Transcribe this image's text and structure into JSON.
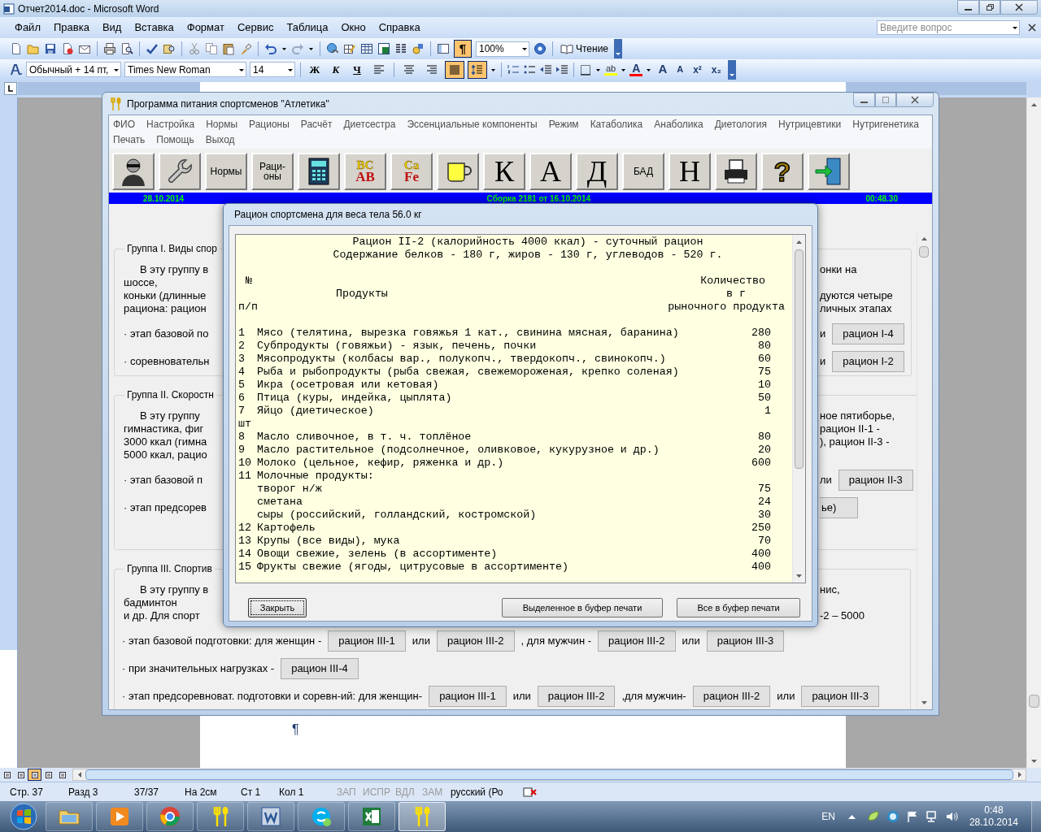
{
  "word": {
    "title": "Отчет2014.doc - Microsoft Word",
    "menu": [
      "Файл",
      "Правка",
      "Вид",
      "Вставка",
      "Формат",
      "Сервис",
      "Таблица",
      "Окно",
      "Справка"
    ],
    "help_box": {
      "placeholder": "Введите вопрос"
    },
    "standard_bar": {
      "pilcrow": {
        "label": "¶",
        "selected": true
      },
      "zoom": "100%",
      "reading": "Чтение"
    },
    "format_bar": {
      "style": "Обычный + 14 пт,",
      "font": "Times New Roman",
      "size": "14",
      "text_buttons": [
        {
          "kind": "bold",
          "label": "Ж",
          "selected": false
        },
        {
          "kind": "italic",
          "label": "К",
          "selected": false
        },
        {
          "kind": "underline",
          "label": "Ч",
          "selected": false
        }
      ],
      "alignment": [
        {
          "kind": "left",
          "selected": false
        },
        {
          "kind": "center",
          "selected": false
        },
        {
          "kind": "right",
          "selected": false
        },
        {
          "kind": "justify",
          "selected": true
        }
      ],
      "line_spacing": {
        "selected": true
      },
      "highlight": "ab",
      "font_color": "A",
      "size_buttons": [
        {
          "kind": "grow",
          "label": "A"
        },
        {
          "kind": "shrink",
          "label": "A"
        },
        {
          "kind": "superscript",
          "label": "x²"
        },
        {
          "kind": "subscript",
          "label": "x₂"
        }
      ]
    },
    "document": {
      "pilcrow": "¶"
    },
    "view_buttons": [
      {
        "selected": false
      },
      {
        "selected": false
      },
      {
        "selected": true
      },
      {
        "selected": false
      },
      {
        "selected": false
      }
    ],
    "status_bar": [
      {
        "text": "Стр. 37",
        "disabled": false
      },
      {
        "text": "Разд 3",
        "disabled": false
      },
      {
        "text": "37/37",
        "disabled": false
      },
      {
        "text": "На 2см",
        "disabled": false
      },
      {
        "text": "Ст 1",
        "disabled": false
      },
      {
        "text": "Кол 1",
        "disabled": false
      },
      {
        "text": "ЗАП",
        "disabled": true
      },
      {
        "text": "ИСПР",
        "disabled": true
      },
      {
        "text": "ВДЛ",
        "disabled": true
      },
      {
        "text": "ЗАМ",
        "disabled": true
      },
      {
        "text": "русский (Ро",
        "disabled": false
      }
    ]
  },
  "app": {
    "title": "Программа питания спортсменов \"Атлетика\"",
    "menu_rows": [
      [
        "ФИО",
        "Настройка",
        "Нормы",
        "Рационы",
        "Расчёт",
        "Диетсестра",
        "Эссенциальные компоненты",
        "Режим",
        "Катаболика",
        "Анаболика",
        "Диетология",
        "Нутрицевтики",
        "Нутригенетика"
      ],
      [
        "Печать",
        "Помощь",
        "Выход"
      ]
    ],
    "toolbar": [
      {
        "kind": "icon"
      },
      {
        "kind": "icon"
      },
      {
        "kind": "text",
        "label": "Нормы"
      },
      {
        "kind": "text",
        "label": "Раци-\nоны"
      },
      {
        "kind": "icon"
      },
      {
        "kind": "letters",
        "top": "BC",
        "bottom": "AB"
      },
      {
        "kind": "letters",
        "top": "Ca",
        "bottom": "Fe"
      },
      {
        "kind": "icon"
      },
      {
        "kind": "letter",
        "label": "К"
      },
      {
        "kind": "letter",
        "label": "А"
      },
      {
        "kind": "letter",
        "label": "Д"
      },
      {
        "kind": "text",
        "label": "БАД"
      },
      {
        "kind": "letter",
        "label": "Н"
      },
      {
        "kind": "icon"
      },
      {
        "kind": "glyph",
        "label": "?"
      },
      {
        "kind": "icon"
      }
    ],
    "info_bar": {
      "date": "28.10.2014",
      "build": "Сборка 2181 от 16.10.2014",
      "time": "00:48.30"
    },
    "groups": [
      {
        "title": "Группа I. Виды спор",
        "lines": [
          {
            "kind": "first",
            "left": [
              {
                "kind": "text",
                "text": "В эту группу в"
              }
            ],
            "right": [
              {
                "kind": "text",
                "text": "онки на"
              }
            ]
          },
          {
            "kind": "text",
            "left": [
              {
                "kind": "text",
                "text": "шоссе,"
              }
            ]
          },
          {
            "kind": "text",
            "left": [
              {
                "kind": "text",
                "text": "коньки (длинные"
              }
            ],
            "right": [
              {
                "kind": "text",
                "text": "дуются четыре"
              }
            ]
          },
          {
            "kind": "text",
            "left": [
              {
                "kind": "text",
                "text": "рациона:  рацион"
              }
            ],
            "right": [
              {
                "kind": "text",
                "text": "личных  этапах"
              }
            ]
          },
          {
            "kind": "controls",
            "left": [
              {
                "kind": "text",
                "text": "· этап базовой по"
              }
            ],
            "right": [
              {
                "kind": "text",
                "text": "и"
              },
              {
                "kind": "button",
                "text": "рацион I-4"
              }
            ]
          },
          {
            "kind": "controls",
            "left": [
              {
                "kind": "text",
                "text": "· соревновательн"
              }
            ],
            "right": [
              {
                "kind": "text",
                "text": "и"
              },
              {
                "kind": "button",
                "text": "рацион I-2"
              }
            ]
          }
        ]
      },
      {
        "title": "Группа II. Скоростн",
        "lines": [
          {
            "kind": "first",
            "left": [
              {
                "kind": "text",
                "text": "В  эту  группу"
              }
            ],
            "right": [
              {
                "kind": "text",
                "text": "ное  пятиборье,"
              }
            ]
          },
          {
            "kind": "text",
            "left": [
              {
                "kind": "text",
                "text": "гимнастика,  фиг"
              }
            ],
            "right": [
              {
                "kind": "text",
                "text": "рацион II-1 -"
              }
            ]
          },
          {
            "kind": "text",
            "left": [
              {
                "kind": "text",
                "text": "3000 ккал (гимна"
              }
            ],
            "right": [
              {
                "kind": "text",
                "text": "), рацион II-3 -"
              }
            ]
          },
          {
            "kind": "text",
            "left": [
              {
                "kind": "text",
                "text": "5000 ккал, рацио"
              }
            ]
          },
          {
            "kind": "controls",
            "left": [
              {
                "kind": "text",
                "text": "· этап базовой п"
              }
            ],
            "right": [
              {
                "kind": "text",
                "text": "ли"
              },
              {
                "kind": "button",
                "text": "рацион II-3"
              }
            ]
          },
          {
            "kind": "controls",
            "left": [
              {
                "kind": "text",
                "text": "· этап предсорев"
              }
            ],
            "right": [
              {
                "kind": "button",
                "text": "ье)"
              }
            ]
          }
        ]
      },
      {
        "title": "Группа III. Спортив",
        "lines": [
          {
            "kind": "first",
            "left": [
              {
                "kind": "text",
                "text": "В эту группу в"
              }
            ],
            "right": [
              {
                "kind": "text",
                "text": "нис,"
              }
            ]
          },
          {
            "kind": "text",
            "left": [
              {
                "kind": "text",
                "text": "бадминтон"
              }
            ]
          },
          {
            "kind": "text",
            "left": [
              {
                "kind": "text",
                "text": "и др.  Для спорт"
              }
            ],
            "right": [
              {
                "kind": "text",
                "text": "-2 – 5000"
              }
            ]
          },
          {
            "kind": "controls",
            "left": [
              {
                "kind": "text",
                "text": "· этап базовой подготовки: для женщин -"
              },
              {
                "kind": "button",
                "text": "рацион III-1"
              },
              {
                "kind": "text",
                "text": "или"
              },
              {
                "kind": "button",
                "text": "рацион III-2"
              },
              {
                "kind": "text",
                "text": ", для мужчин -"
              },
              {
                "kind": "button",
                "text": "рацион III-2"
              },
              {
                "kind": "text",
                "text": "или"
              },
              {
                "kind": "button",
                "text": "рацион III-3"
              }
            ]
          },
          {
            "kind": "controls",
            "left": [
              {
                "kind": "text",
                "text": "· при значительных нагрузках  -"
              },
              {
                "kind": "button",
                "text": "рацион III-4"
              }
            ]
          },
          {
            "kind": "controls",
            "left": [
              {
                "kind": "text",
                "text": "· этап предсоревноват. подготовки и соревн-ий: для женщин-"
              },
              {
                "kind": "button",
                "text": "рацион III-1"
              },
              {
                "kind": "text",
                "text": "или"
              },
              {
                "kind": "button",
                "text": "рацион III-2"
              },
              {
                "kind": "text",
                "text": ",для мужчин-"
              },
              {
                "kind": "button",
                "text": "рацион III-2"
              },
              {
                "kind": "text",
                "text": "или"
              },
              {
                "kind": "button",
                "text": "рацион III-3"
              }
            ]
          }
        ]
      }
    ]
  },
  "dialog": {
    "title": "Рацион спортсмена для веса тела 56.0 кг",
    "heading": [
      "Рацион II-2 (калорийность 4000 ккал) - суточный рацион",
      "Содержание белков - 180 г, жиров - 130 г, углеводов - 520 г."
    ],
    "columns": {
      "number": [
        "№",
        "п/п"
      ],
      "product": "Продукты",
      "quantity": [
        "Количество",
        "в г",
        "рыночного продукта"
      ]
    },
    "rows": [
      {
        "number": "1",
        "name": "Мясо (телятина, вырезка говяжья 1 кат., свинина мясная, баранина)",
        "quantity": "280"
      },
      {
        "number": "2",
        "name": "Субпродукты (говяжьи) - язык, печень, почки",
        "quantity": "80"
      },
      {
        "number": "3",
        "name": "Мясопродукты (колбасы вар., полукопч., твердокопч., свинокопч.)",
        "quantity": "60"
      },
      {
        "number": "4",
        "name": "Рыба и рыбопродукты (рыба свежая, свежемороженая, крепко соленая)",
        "quantity": "75"
      },
      {
        "number": "5",
        "name": "Икра (осетровая или кетовая)",
        "quantity": "10"
      },
      {
        "number": "6",
        "name": "Птица (куры, индейка, цыплята)",
        "quantity": "50"
      },
      {
        "number": "7",
        "name": "Яйцо (диетическое)",
        "quantity": "1",
        "unit": "шт"
      },
      {
        "number": "8",
        "name": "Масло сливочное, в т. ч. топлёное",
        "quantity": "80"
      },
      {
        "number": "9",
        "name": "Масло растительное (подсолнечное, оливковое, кукурузное и др.)",
        "quantity": "20"
      },
      {
        "number": "10",
        "name": "Молоко (цельное, кефир, ряженка и др.)",
        "quantity": "600"
      },
      {
        "number": "11",
        "name": "Молочные продукты:",
        "children": [
          {
            "name": "творог н/ж",
            "quantity": "75"
          },
          {
            "name": "сметана",
            "quantity": "24"
          },
          {
            "name": "сыры (российский, голландский, костромской)",
            "quantity": "30"
          }
        ]
      },
      {
        "number": "12",
        "name": "Картофель",
        "quantity": "250"
      },
      {
        "number": "13",
        "name": "Крупы (все виды), мука",
        "quantity": "70"
      },
      {
        "number": "14",
        "name": "Овощи свежие, зелень (в ассортименте)",
        "quantity": "400"
      },
      {
        "number": "15",
        "name": "Фрукты свежие (ягоды, цитрусовые в ассортименте)",
        "quantity": "400"
      }
    ],
    "buttons": [
      {
        "label": "Закрыть",
        "focused": true
      },
      {
        "label": "Выделенное в буфер печати",
        "focused": false
      },
      {
        "label": "Все в буфер печати",
        "focused": false
      }
    ]
  },
  "taskbar": {
    "items": [
      {
        "active": false
      },
      {
        "active": false
      },
      {
        "active": false
      },
      {
        "active": false
      },
      {
        "active": false
      },
      {
        "active": false
      },
      {
        "active": false
      },
      {
        "active": true
      }
    ],
    "language": "EN",
    "time": "0:48",
    "date": "28.10.2014"
  }
}
